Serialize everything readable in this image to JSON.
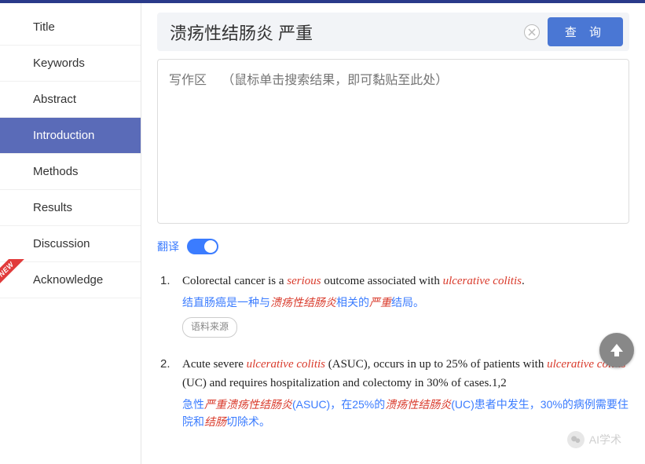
{
  "sidebar": {
    "items": [
      {
        "label": "Title"
      },
      {
        "label": "Keywords"
      },
      {
        "label": "Abstract"
      },
      {
        "label": "Introduction",
        "active": true
      },
      {
        "label": "Methods"
      },
      {
        "label": "Results"
      },
      {
        "label": "Discussion"
      },
      {
        "label": "Acknowledge",
        "badge": "NEW"
      }
    ]
  },
  "search": {
    "value": "溃疡性结肠炎 严重",
    "query_button": "查 询"
  },
  "writing_area": {
    "placeholder": "写作区  （鼠标单击搜索结果，即可黏贴至此处）"
  },
  "translate": {
    "label": "翻译",
    "on": true
  },
  "results": [
    {
      "num": "1.",
      "en_parts": [
        "Colorectal cancer is a ",
        {
          "em": "serious"
        },
        " outcome associated with ",
        {
          "em": "ulcerative colitis"
        },
        "."
      ],
      "zh_parts": [
        "结直肠癌是一种与",
        {
          "em": "溃疡性结肠炎"
        },
        "相关的",
        {
          "em": "严重"
        },
        "结局。"
      ],
      "source_btn": "语料来源"
    },
    {
      "num": "2.",
      "en_parts": [
        "Acute severe ",
        {
          "em": "ulcerative colitis"
        },
        " (ASUC), occurs in up to 25% of patients with ",
        {
          "em": "ulcerative colitis"
        },
        " (UC) and requires hospitalization and colectomy in 30% of cases.1,2"
      ],
      "zh_parts": [
        "急性",
        {
          "em": "严重溃疡性结肠炎"
        },
        "(ASUC)，在25%的",
        {
          "em": "溃疡性结肠炎"
        },
        "(UC)患者中发生，30%的病例需要住院和",
        {
          "em": "结肠"
        },
        "切除术。"
      ]
    }
  ],
  "watermark": {
    "text": "AI学术"
  }
}
